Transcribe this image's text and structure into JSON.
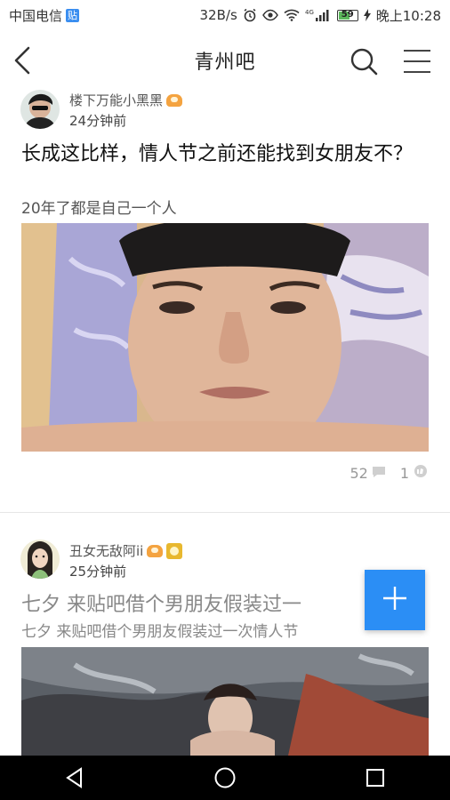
{
  "status_bar": {
    "carrier": "中国电信",
    "carrier_badge": "贴",
    "speed": "32B/s",
    "signal_label": "4G",
    "battery": "59",
    "time": "晚上10:28"
  },
  "header": {
    "title": "青州吧",
    "icons": [
      "back-icon",
      "search-icon",
      "menu-icon"
    ]
  },
  "posts": [
    {
      "author": "楼下万能小黑黑",
      "time": "24分钟前",
      "title": "长成这比样，情人节之前还能找到女朋友不？",
      "desc": "20年了都是自己一个人",
      "stats": {
        "replies": "52",
        "likes": "1"
      }
    },
    {
      "author": "丑女无敌阿ii",
      "time": "25分钟前",
      "title": "七夕 来贴吧借个男朋友假装过一",
      "desc": "七夕 来贴吧借个男朋友假装过一次情人节"
    }
  ],
  "colors": {
    "accent": "#2b8ef5",
    "nav_bar": "#000000"
  }
}
